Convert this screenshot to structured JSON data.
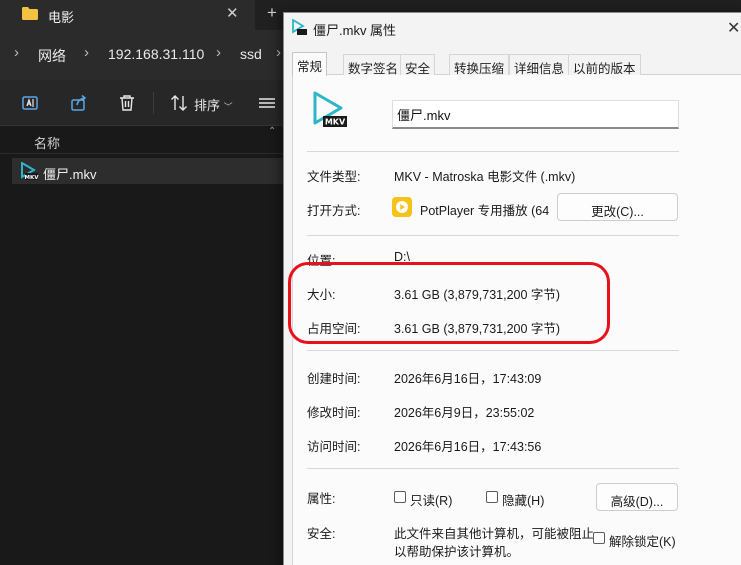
{
  "explorer": {
    "tab_title": "电影",
    "tab_close": "✕",
    "new_tab": "+",
    "breadcrumbs": [
      "网络",
      "192.168.31.110",
      "ssd"
    ],
    "sort_label": "排序",
    "column_name": "名称",
    "file_name": "僵尸.mkv",
    "colors": {
      "background": "#191919",
      "folder": "#f3c242"
    }
  },
  "dialog": {
    "title": "僵尸.mkv 属性",
    "close": "✕",
    "tabs": [
      "常规",
      "数字签名",
      "安全",
      "转换压缩",
      "详细信息",
      "以前的版本"
    ],
    "active_tab": "常规",
    "file_name_value": "僵尸.mkv",
    "file_type_label": "文件类型:",
    "file_type_value": "MKV - Matroska 电影文件 (.mkv)",
    "open_with_label": "打开方式:",
    "open_with_value": "PotPlayer 专用播放 (64",
    "change_button": "更改(C)...",
    "location_label": "位置:",
    "location_value": "D:\\",
    "size_label": "大小:",
    "size_value": "3.61 GB (3,879,731,200 字节)",
    "size_on_disk_label": "占用空间:",
    "size_on_disk_value": "3.61 GB (3,879,731,200 字节)",
    "created_label": "创建时间:",
    "created_value": "2026年6月16日，17:43:09",
    "modified_label": "修改时间:",
    "modified_value": "2026年6月9日，23:55:02",
    "accessed_label": "访问时间:",
    "accessed_value": "2026年6月16日，17:43:56",
    "attributes_label": "属性:",
    "readonly_label": "只读(R)",
    "hidden_label": "隐藏(H)",
    "advanced_button": "高级(D)...",
    "security_label": "安全:",
    "security_text_1": "此文件来自其他计算机，可能被阻止",
    "security_text_2": "以帮助保护该计算机。",
    "unblock_label": "解除锁定(K)",
    "colors": {
      "highlight": "#e8101a",
      "mkv_icon": "#2bb7c9",
      "potplayer": "#f5c21a"
    }
  }
}
